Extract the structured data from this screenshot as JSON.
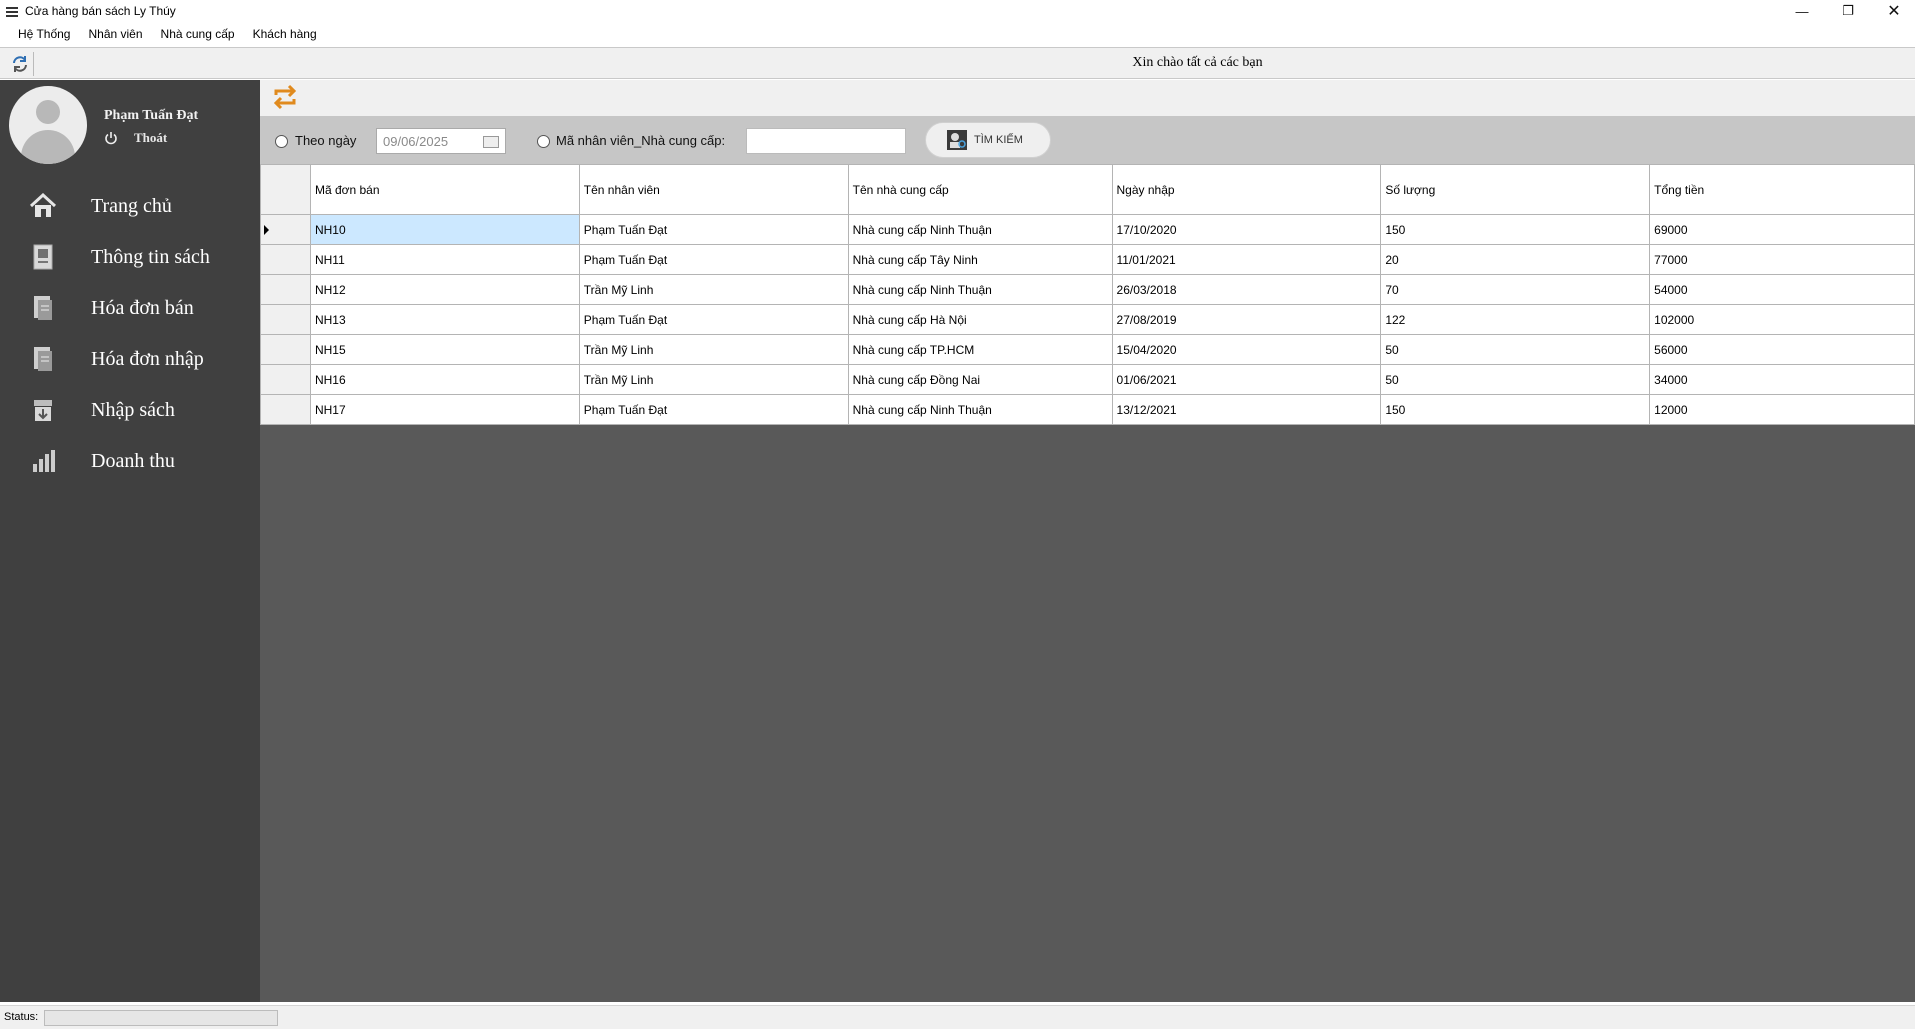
{
  "window": {
    "title": "Cửa hàng bán sách Ly Thúy"
  },
  "menu": {
    "items": [
      "Hệ Thống",
      "Nhân viên",
      "Nhà cung cấp",
      "Khách hàng"
    ]
  },
  "header": {
    "greeting": "Xin chào tất cả các bạn"
  },
  "user": {
    "name": "Phạm Tuấn Đạt",
    "logout_label": "Thoát"
  },
  "sidebar": {
    "items": [
      {
        "label": "Trang chủ",
        "icon": "home-icon"
      },
      {
        "label": "Thông tin sách",
        "icon": "book-info-icon"
      },
      {
        "label": "Hóa đơn bán",
        "icon": "sales-invoice-icon"
      },
      {
        "label": "Hóa đơn nhập",
        "icon": "import-invoice-icon"
      },
      {
        "label": "Nhập sách",
        "icon": "import-book-icon"
      },
      {
        "label": "Doanh thu",
        "icon": "revenue-chart-icon"
      }
    ]
  },
  "filter": {
    "by_date_label": "Theo ngày",
    "date_value": "09/06/2025",
    "by_staff_supplier_label": "Mã nhân viên_Nhà cung cấp:",
    "search_value": "",
    "search_button_label": "TÌM KIẾM"
  },
  "grid": {
    "columns": [
      "Mã đơn bán",
      "Tên nhân viên",
      "Tên nhà cung cấp",
      "Ngày nhập",
      "Số lượng",
      "Tổng tiền"
    ],
    "rows": [
      [
        "NH10",
        "Phạm Tuấn Đạt",
        "Nhà cung cấp Ninh Thuận",
        "17/10/2020",
        "150",
        "69000"
      ],
      [
        "NH11",
        "Phạm Tuấn Đạt",
        "Nhà cung cấp Tây Ninh",
        "11/01/2021",
        "20",
        "77000"
      ],
      [
        "NH12",
        "Trần Mỹ Linh",
        "Nhà cung cấp Ninh Thuận",
        "26/03/2018",
        "70",
        "54000"
      ],
      [
        "NH13",
        "Phạm Tuấn Đạt",
        "Nhà cung cấp Hà Nội",
        "27/08/2019",
        "122",
        "102000"
      ],
      [
        "NH15",
        "Trần Mỹ Linh",
        "Nhà cung cấp TP.HCM",
        "15/04/2020",
        "50",
        "56000"
      ],
      [
        "NH16",
        "Trần Mỹ Linh",
        "Nhà cung cấp Đồng Nai",
        "01/06/2021",
        "50",
        "34000"
      ],
      [
        "NH17",
        "Phạm Tuấn Đạt",
        "Nhà cung cấp Ninh Thuận",
        "13/12/2021",
        "150",
        "12000"
      ]
    ],
    "selected_row": 0
  },
  "status": {
    "label": "Status:"
  }
}
